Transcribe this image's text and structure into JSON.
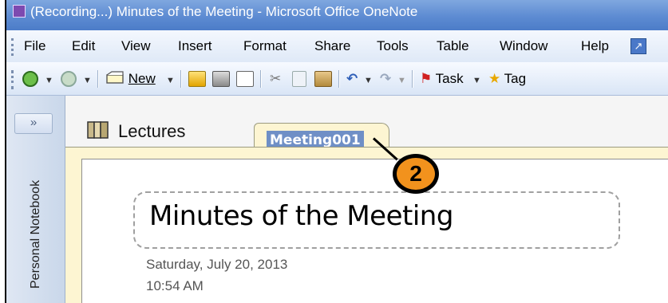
{
  "window": {
    "title": "(Recording...) Minutes of the Meeting - Microsoft Office OneNote"
  },
  "menu": {
    "items": [
      "File",
      "Edit",
      "View",
      "Insert",
      "Format",
      "Share",
      "Tools",
      "Table",
      "Window",
      "Help"
    ]
  },
  "toolbar": {
    "new_label": "New",
    "task_label": "Task",
    "tag_label": "Tag"
  },
  "notebook": {
    "expand_label": "»",
    "name": "Personal Notebook"
  },
  "sections": {
    "lectures": "Lectures",
    "active": "Meeting001"
  },
  "page": {
    "title": "Minutes of the Meeting",
    "date": "Saturday, July 20, 2013",
    "time": "10:54 AM"
  },
  "callout": {
    "number": "2",
    "color": "#f2921d"
  },
  "colors": {
    "titlebar": "#5d8bd2",
    "page_bg": "#fdf5d2",
    "selection": "#6f8fc6"
  }
}
